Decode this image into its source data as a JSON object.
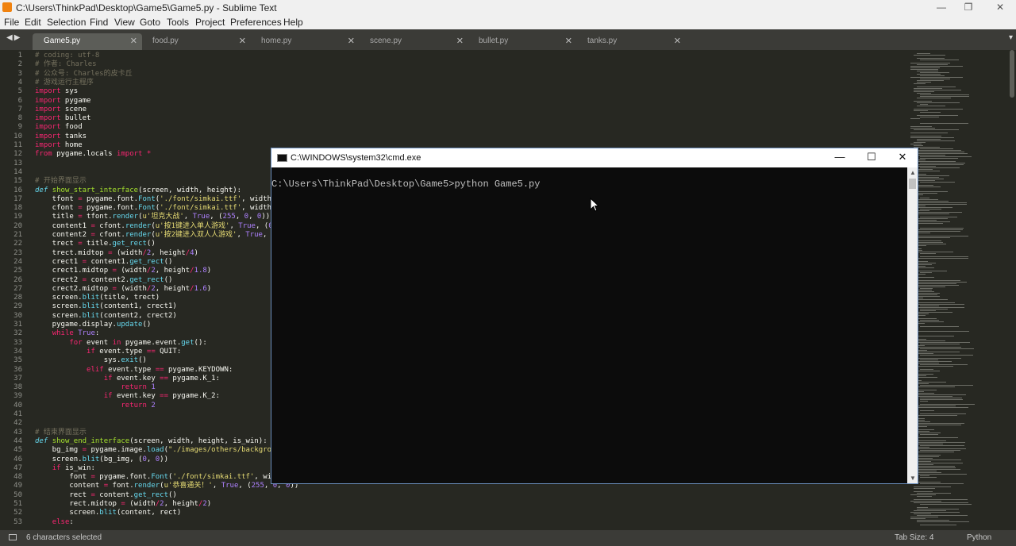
{
  "window": {
    "title": "C:\\Users\\ThinkPad\\Desktop\\Game5\\Game5.py - Sublime Text",
    "minimize": "—",
    "maximize": "❐",
    "close": "✕"
  },
  "menu": [
    "File",
    "Edit",
    "Selection",
    "Find",
    "View",
    "Goto",
    "Tools",
    "Project",
    "Preferences",
    "Help"
  ],
  "nav_arrows": "◀▶",
  "tab_dropdown": "▾",
  "tabs": [
    {
      "label": "Game5.py",
      "active": true
    },
    {
      "label": "food.py",
      "active": false
    },
    {
      "label": "home.py",
      "active": false
    },
    {
      "label": "scene.py",
      "active": false
    },
    {
      "label": "bullet.py",
      "active": false
    },
    {
      "label": "tanks.py",
      "active": false
    }
  ],
  "tab_close": "✕",
  "code_lines": [
    "# coding: utf-8",
    "# 作者: Charles",
    "# 公众号: Charles的皮卡丘",
    "# 游戏运行主程序",
    "import sys",
    "import pygame",
    "import scene",
    "import bullet",
    "import food",
    "import tanks",
    "import home",
    "from pygame.locals import *",
    "",
    "",
    "# 开始界面显示",
    "def show_start_interface(screen, width, height):",
    "    tfont = pygame.font.Font('./font/simkai.ttf', width//4)",
    "    cfont = pygame.font.Font('./font/simkai.ttf', width//20)",
    "    title = tfont.render(u'坦克大战', True, (255, 0, 0))",
    "    content1 = cfont.render(u'按1键进入单人游戏', True, (0, 0, 255))",
    "    content2 = cfont.render(u'按2键进入双人人游戏', True, (0, 0, 255))",
    "    trect = title.get_rect()",
    "    trect.midtop = (width/2, height/4)",
    "    crect1 = content1.get_rect()",
    "    crect1.midtop = (width/2, height/1.8)",
    "    crect2 = content2.get_rect()",
    "    crect2.midtop = (width/2, height/1.6)",
    "    screen.blit(title, trect)",
    "    screen.blit(content1, crect1)",
    "    screen.blit(content2, crect2)",
    "    pygame.display.update()",
    "    while True:",
    "        for event in pygame.event.get():",
    "            if event.type == QUIT:",
    "                sys.exit()",
    "            elif event.type == pygame.KEYDOWN:",
    "                if event.key == pygame.K_1:",
    "                    return 1",
    "                if event.key == pygame.K_2:",
    "                    return 2",
    "",
    "",
    "# 结束界面显示",
    "def show_end_interface(screen, width, height, is_win):",
    "    bg_img = pygame.image.load(\"./images/others/background.png\")",
    "    screen.blit(bg_img, (0, 0))",
    "    if is_win:",
    "        font = pygame.font.Font('./font/simkai.ttf', width//10)",
    "        content = font.render(u'恭喜通关！', True, (255, 0, 0))",
    "        rect = content.get_rect()",
    "        rect.midtop = (width/2, height/2)",
    "        screen.blit(content, rect)",
    "    else:"
  ],
  "cmd": {
    "title": "C:\\WINDOWS\\system32\\cmd.exe",
    "minimize": "—",
    "maximize": "☐",
    "close": "✕",
    "line": "C:\\Users\\ThinkPad\\Desktop\\Game5>python Game5.py",
    "scroll_up": "▲",
    "scroll_down": "▼"
  },
  "status": {
    "selection": "6 characters selected",
    "tab_size": "Tab Size: 4",
    "syntax": "Python"
  }
}
